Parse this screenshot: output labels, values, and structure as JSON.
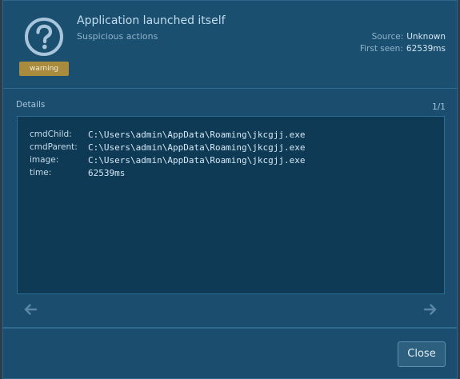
{
  "header": {
    "title": "Application launched itself",
    "subtitle": "Suspicious actions",
    "badge": "warning",
    "source_label": "Source:",
    "source_value": "Unknown",
    "first_seen_label": "First seen:",
    "first_seen_value": "62539ms"
  },
  "details": {
    "label": "Details",
    "pager": "1/1",
    "rows": [
      {
        "key": "cmdChild:",
        "value": "C:\\Users\\admin\\AppData\\Roaming\\jkcgjj.exe"
      },
      {
        "key": "cmdParent:",
        "value": "C:\\Users\\admin\\AppData\\Roaming\\jkcgjj.exe"
      },
      {
        "key": "image:",
        "value": "C:\\Users\\admin\\AppData\\Roaming\\jkcgjj.exe"
      },
      {
        "key": "time:",
        "value": "62539ms"
      }
    ]
  },
  "footer": {
    "close_label": "Close"
  },
  "icons": {
    "status": "question-circle-icon",
    "prev": "arrow-left-icon",
    "next": "arrow-right-icon"
  },
  "colors": {
    "badge": "#a98b3e",
    "panel": "#1a4d6e",
    "detail_box": "#0e3a56"
  }
}
